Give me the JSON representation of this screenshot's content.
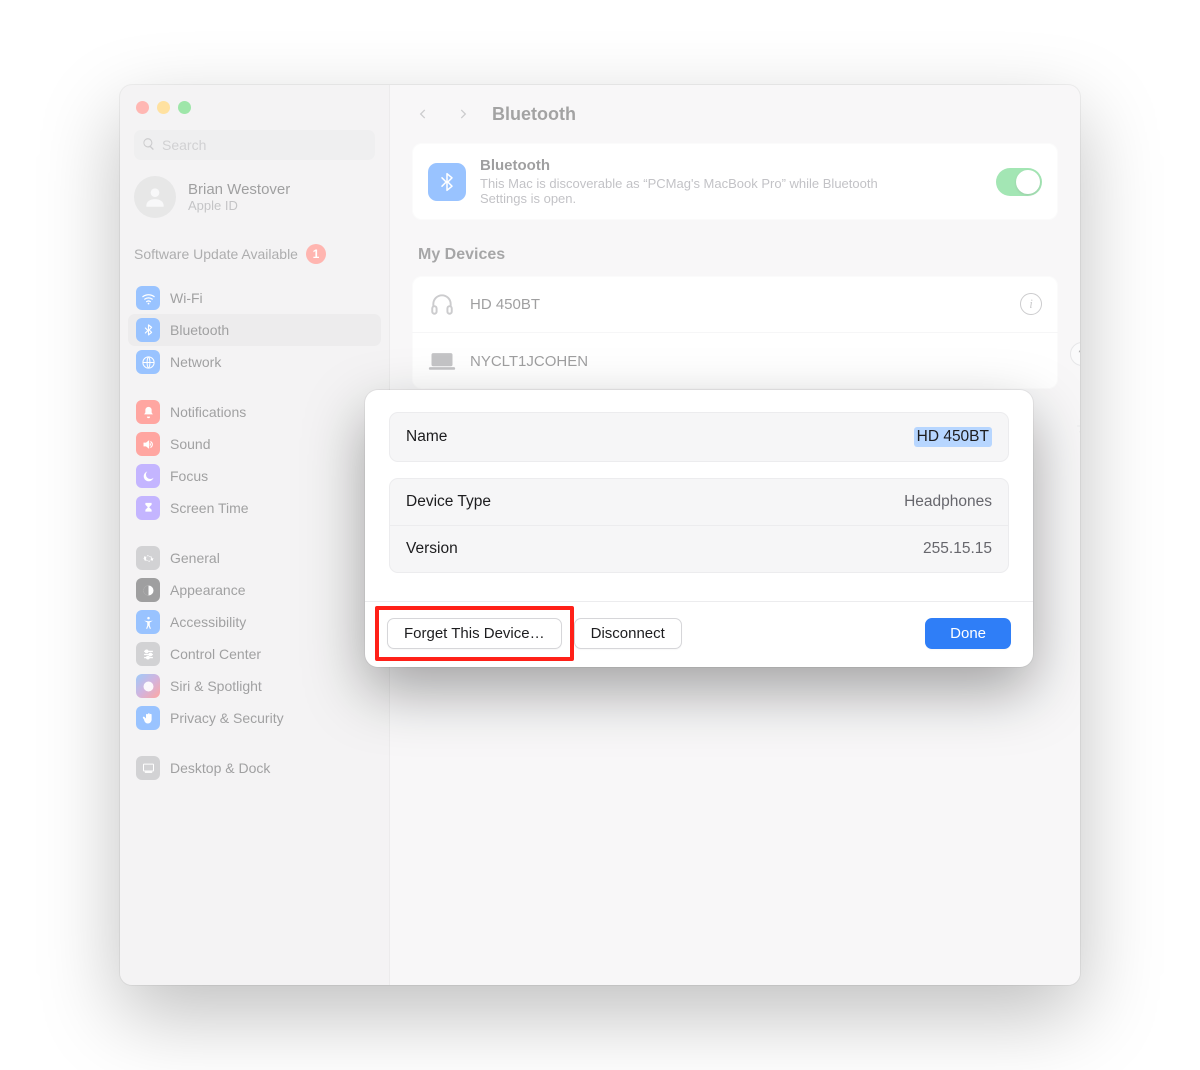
{
  "window_title": "Bluetooth",
  "search": {
    "placeholder": "Search"
  },
  "account": {
    "name": "Brian Westover",
    "sub": "Apple ID"
  },
  "software_update": {
    "label": "Software Update Available",
    "badge": "1"
  },
  "sidebar": {
    "groups": [
      [
        {
          "label": "Wi-Fi",
          "color": "c-blue",
          "icon": "wifi"
        },
        {
          "label": "Bluetooth",
          "color": "c-blue",
          "icon": "bluetooth",
          "selected": true
        },
        {
          "label": "Network",
          "color": "c-blue",
          "icon": "globe"
        }
      ],
      [
        {
          "label": "Notifications",
          "color": "c-red",
          "icon": "bell"
        },
        {
          "label": "Sound",
          "color": "c-red",
          "icon": "sound"
        },
        {
          "label": "Focus",
          "color": "c-purple",
          "icon": "moon"
        },
        {
          "label": "Screen Time",
          "color": "c-purple",
          "icon": "hourglass"
        }
      ],
      [
        {
          "label": "General",
          "color": "c-gray",
          "icon": "gear"
        },
        {
          "label": "Appearance",
          "color": "c-black",
          "icon": "appearance"
        },
        {
          "label": "Accessibility",
          "color": "c-blue",
          "icon": "accessibility"
        },
        {
          "label": "Control Center",
          "color": "c-gray",
          "icon": "sliders"
        },
        {
          "label": "Siri & Spotlight",
          "color": "c-siri",
          "icon": "siri"
        },
        {
          "label": "Privacy & Security",
          "color": "c-hand",
          "icon": "hand"
        }
      ],
      [
        {
          "label": "Desktop & Dock",
          "color": "c-gray",
          "icon": "dock"
        }
      ]
    ]
  },
  "bluetooth_card": {
    "title": "Bluetooth",
    "sub": "This Mac is discoverable as “PCMag's MacBook Pro” while Bluetooth Settings is open.",
    "enabled": true
  },
  "devices_section_title": "My Devices",
  "devices": [
    {
      "name": "HD 450BT",
      "icon": "headphones",
      "info": true
    },
    {
      "name": "NYCLT1JCOHEN",
      "icon": "laptop"
    }
  ],
  "modal": {
    "name_row": {
      "label": "Name",
      "value": "HD 450BT"
    },
    "type_row": {
      "label": "Device Type",
      "value": "Headphones"
    },
    "version_row": {
      "label": "Version",
      "value": "255.15.15"
    },
    "forget_btn": "Forget This Device…",
    "disconnect_btn": "Disconnect",
    "done_btn": "Done"
  }
}
